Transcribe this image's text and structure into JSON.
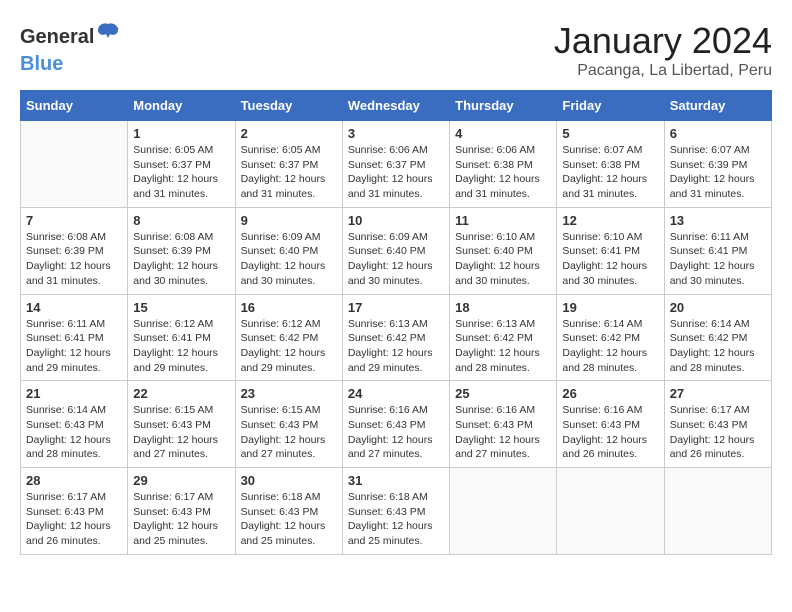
{
  "header": {
    "logo": {
      "general": "General",
      "blue": "Blue"
    },
    "title": "January 2024",
    "subtitle": "Pacanga, La Libertad, Peru"
  },
  "weekdays": [
    "Sunday",
    "Monday",
    "Tuesday",
    "Wednesday",
    "Thursday",
    "Friday",
    "Saturday"
  ],
  "weeks": [
    [
      {
        "date": "",
        "sunrise": "",
        "sunset": "",
        "daylight": "",
        "empty": true
      },
      {
        "date": "1",
        "sunrise": "Sunrise: 6:05 AM",
        "sunset": "Sunset: 6:37 PM",
        "daylight": "Daylight: 12 hours and 31 minutes."
      },
      {
        "date": "2",
        "sunrise": "Sunrise: 6:05 AM",
        "sunset": "Sunset: 6:37 PM",
        "daylight": "Daylight: 12 hours and 31 minutes."
      },
      {
        "date": "3",
        "sunrise": "Sunrise: 6:06 AM",
        "sunset": "Sunset: 6:37 PM",
        "daylight": "Daylight: 12 hours and 31 minutes."
      },
      {
        "date": "4",
        "sunrise": "Sunrise: 6:06 AM",
        "sunset": "Sunset: 6:38 PM",
        "daylight": "Daylight: 12 hours and 31 minutes."
      },
      {
        "date": "5",
        "sunrise": "Sunrise: 6:07 AM",
        "sunset": "Sunset: 6:38 PM",
        "daylight": "Daylight: 12 hours and 31 minutes."
      },
      {
        "date": "6",
        "sunrise": "Sunrise: 6:07 AM",
        "sunset": "Sunset: 6:39 PM",
        "daylight": "Daylight: 12 hours and 31 minutes."
      }
    ],
    [
      {
        "date": "7",
        "sunrise": "Sunrise: 6:08 AM",
        "sunset": "Sunset: 6:39 PM",
        "daylight": "Daylight: 12 hours and 31 minutes."
      },
      {
        "date": "8",
        "sunrise": "Sunrise: 6:08 AM",
        "sunset": "Sunset: 6:39 PM",
        "daylight": "Daylight: 12 hours and 30 minutes."
      },
      {
        "date": "9",
        "sunrise": "Sunrise: 6:09 AM",
        "sunset": "Sunset: 6:40 PM",
        "daylight": "Daylight: 12 hours and 30 minutes."
      },
      {
        "date": "10",
        "sunrise": "Sunrise: 6:09 AM",
        "sunset": "Sunset: 6:40 PM",
        "daylight": "Daylight: 12 hours and 30 minutes."
      },
      {
        "date": "11",
        "sunrise": "Sunrise: 6:10 AM",
        "sunset": "Sunset: 6:40 PM",
        "daylight": "Daylight: 12 hours and 30 minutes."
      },
      {
        "date": "12",
        "sunrise": "Sunrise: 6:10 AM",
        "sunset": "Sunset: 6:41 PM",
        "daylight": "Daylight: 12 hours and 30 minutes."
      },
      {
        "date": "13",
        "sunrise": "Sunrise: 6:11 AM",
        "sunset": "Sunset: 6:41 PM",
        "daylight": "Daylight: 12 hours and 30 minutes."
      }
    ],
    [
      {
        "date": "14",
        "sunrise": "Sunrise: 6:11 AM",
        "sunset": "Sunset: 6:41 PM",
        "daylight": "Daylight: 12 hours and 29 minutes."
      },
      {
        "date": "15",
        "sunrise": "Sunrise: 6:12 AM",
        "sunset": "Sunset: 6:41 PM",
        "daylight": "Daylight: 12 hours and 29 minutes."
      },
      {
        "date": "16",
        "sunrise": "Sunrise: 6:12 AM",
        "sunset": "Sunset: 6:42 PM",
        "daylight": "Daylight: 12 hours and 29 minutes."
      },
      {
        "date": "17",
        "sunrise": "Sunrise: 6:13 AM",
        "sunset": "Sunset: 6:42 PM",
        "daylight": "Daylight: 12 hours and 29 minutes."
      },
      {
        "date": "18",
        "sunrise": "Sunrise: 6:13 AM",
        "sunset": "Sunset: 6:42 PM",
        "daylight": "Daylight: 12 hours and 28 minutes."
      },
      {
        "date": "19",
        "sunrise": "Sunrise: 6:14 AM",
        "sunset": "Sunset: 6:42 PM",
        "daylight": "Daylight: 12 hours and 28 minutes."
      },
      {
        "date": "20",
        "sunrise": "Sunrise: 6:14 AM",
        "sunset": "Sunset: 6:42 PM",
        "daylight": "Daylight: 12 hours and 28 minutes."
      }
    ],
    [
      {
        "date": "21",
        "sunrise": "Sunrise: 6:14 AM",
        "sunset": "Sunset: 6:43 PM",
        "daylight": "Daylight: 12 hours and 28 minutes."
      },
      {
        "date": "22",
        "sunrise": "Sunrise: 6:15 AM",
        "sunset": "Sunset: 6:43 PM",
        "daylight": "Daylight: 12 hours and 27 minutes."
      },
      {
        "date": "23",
        "sunrise": "Sunrise: 6:15 AM",
        "sunset": "Sunset: 6:43 PM",
        "daylight": "Daylight: 12 hours and 27 minutes."
      },
      {
        "date": "24",
        "sunrise": "Sunrise: 6:16 AM",
        "sunset": "Sunset: 6:43 PM",
        "daylight": "Daylight: 12 hours and 27 minutes."
      },
      {
        "date": "25",
        "sunrise": "Sunrise: 6:16 AM",
        "sunset": "Sunset: 6:43 PM",
        "daylight": "Daylight: 12 hours and 27 minutes."
      },
      {
        "date": "26",
        "sunrise": "Sunrise: 6:16 AM",
        "sunset": "Sunset: 6:43 PM",
        "daylight": "Daylight: 12 hours and 26 minutes."
      },
      {
        "date": "27",
        "sunrise": "Sunrise: 6:17 AM",
        "sunset": "Sunset: 6:43 PM",
        "daylight": "Daylight: 12 hours and 26 minutes."
      }
    ],
    [
      {
        "date": "28",
        "sunrise": "Sunrise: 6:17 AM",
        "sunset": "Sunset: 6:43 PM",
        "daylight": "Daylight: 12 hours and 26 minutes."
      },
      {
        "date": "29",
        "sunrise": "Sunrise: 6:17 AM",
        "sunset": "Sunset: 6:43 PM",
        "daylight": "Daylight: 12 hours and 25 minutes."
      },
      {
        "date": "30",
        "sunrise": "Sunrise: 6:18 AM",
        "sunset": "Sunset: 6:43 PM",
        "daylight": "Daylight: 12 hours and 25 minutes."
      },
      {
        "date": "31",
        "sunrise": "Sunrise: 6:18 AM",
        "sunset": "Sunset: 6:43 PM",
        "daylight": "Daylight: 12 hours and 25 minutes."
      },
      {
        "date": "",
        "sunrise": "",
        "sunset": "",
        "daylight": "",
        "empty": true
      },
      {
        "date": "",
        "sunrise": "",
        "sunset": "",
        "daylight": "",
        "empty": true
      },
      {
        "date": "",
        "sunrise": "",
        "sunset": "",
        "daylight": "",
        "empty": true
      }
    ]
  ]
}
